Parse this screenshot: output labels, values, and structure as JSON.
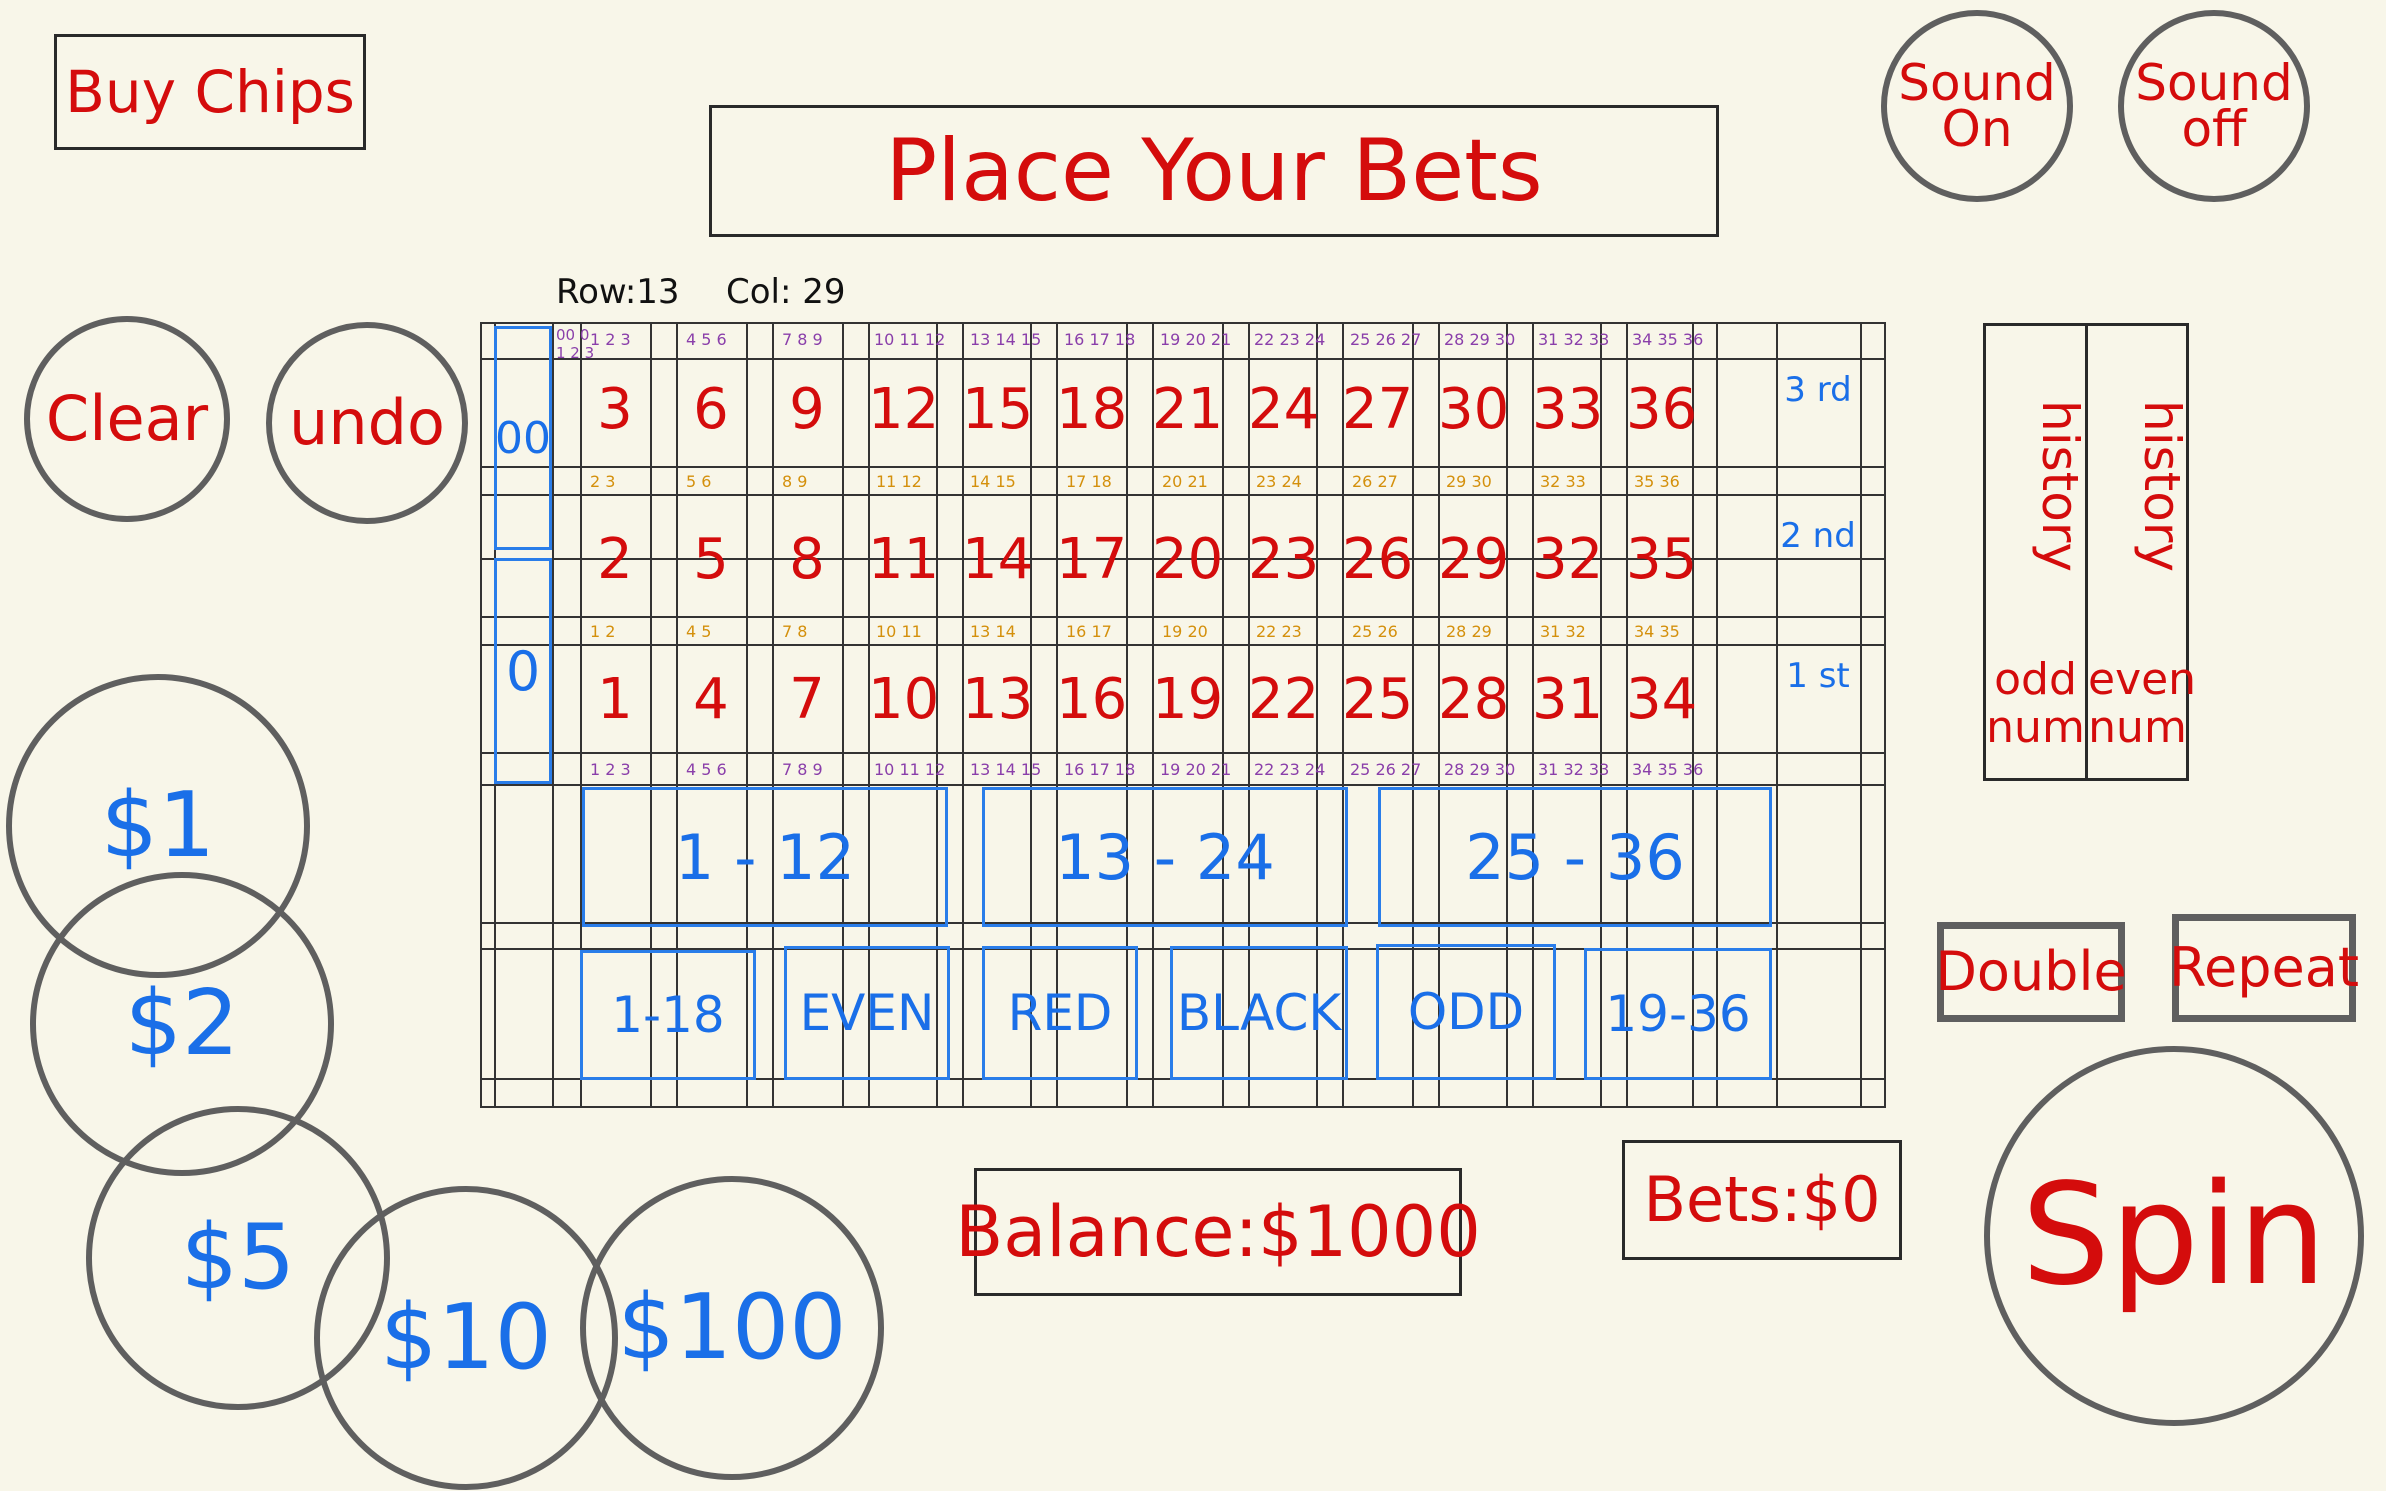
{
  "header": {
    "buy_chips": "Buy Chips",
    "title": "Place Your Bets",
    "sound_on": [
      "Sound",
      "On"
    ],
    "sound_off": [
      "Sound",
      "off"
    ]
  },
  "controls": {
    "clear": "Clear",
    "undo": "undo",
    "double": "Double",
    "repeat": "Repeat",
    "spin": "Spin"
  },
  "coords": {
    "row": "Row:13",
    "col": "Col: 29"
  },
  "table": {
    "zeros": [
      "00",
      "0"
    ],
    "numbers_row3": [
      "3",
      "6",
      "9",
      "12",
      "15",
      "18",
      "21",
      "24",
      "27",
      "30",
      "33",
      "36"
    ],
    "numbers_row2": [
      "2",
      "5",
      "8",
      "11",
      "14",
      "17",
      "20",
      "23",
      "26",
      "29",
      "32",
      "35"
    ],
    "numbers_row1": [
      "1",
      "4",
      "7",
      "10",
      "13",
      "16",
      "19",
      "22",
      "25",
      "28",
      "31",
      "34"
    ],
    "columns": [
      "3 rd",
      "2 nd",
      "1 st"
    ],
    "dozens": [
      "1 - 12",
      "13 - 24",
      "25 - 36"
    ],
    "outside": [
      "1-18",
      "EVEN",
      "RED",
      "BLACK",
      "ODD",
      "19-36"
    ],
    "street_top": [
      "1 2 3",
      "4 5 6",
      "7 8 9",
      "10 11 12",
      "13 14 15",
      "16 17 18",
      "19 20 21",
      "22 23 24",
      "25 26 27",
      "28 29 30",
      "31 32 33",
      "34 35 36"
    ],
    "split_row3_2": [
      "2 3",
      "5 6",
      "8 9",
      "11 12",
      "14 15",
      "17 18",
      "20 21",
      "23 24",
      "26 27",
      "29 30",
      "32 33",
      "35 36"
    ],
    "split_row2_1": [
      "1 2",
      "4 5",
      "7 8",
      "10 11",
      "13 14",
      "16 17",
      "19 20",
      "22 23",
      "25 26",
      "28 29",
      "31 32",
      "34 35"
    ]
  },
  "history": {
    "odd_label": [
      "odd",
      "num"
    ],
    "even_label": [
      "even",
      "num"
    ],
    "heading": "history"
  },
  "chips": [
    "$1",
    "$2",
    "$5",
    "$10",
    "$100"
  ],
  "status": {
    "balance": "Balance:$1000",
    "bets": "Bets:$0"
  },
  "colors": {
    "red": "#d40c0c",
    "blue": "#1a6fe8",
    "border": "#5f5f5f",
    "background": "#f8f6e9"
  }
}
